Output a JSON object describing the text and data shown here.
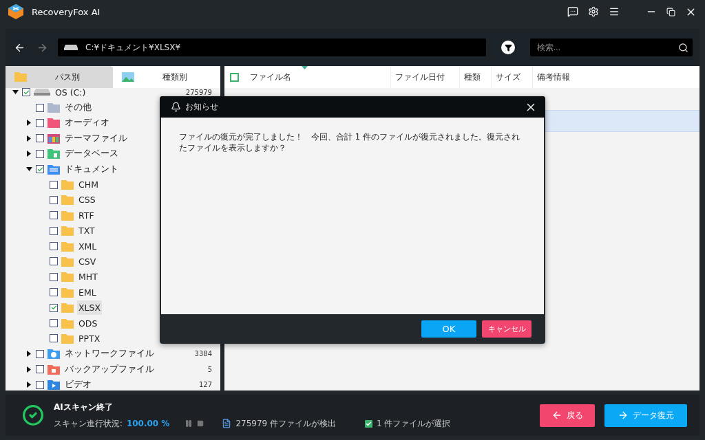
{
  "window": {
    "title": "RecoveryFox AI"
  },
  "toolbar": {
    "path": "C:¥ドキュメント¥XLSX¥",
    "search": {
      "placeholder": "検索..."
    }
  },
  "tabs": [
    {
      "label": "パス別",
      "selected": true
    },
    {
      "label": "種類別",
      "selected": false
    }
  ],
  "tree": [
    {
      "label": "OS (C:)",
      "count": "275979",
      "kind": "drive",
      "checked": true,
      "expanded": true,
      "selected": false,
      "children": [
        {
          "label": "その他",
          "kind": "other",
          "checked": false,
          "selected": false
        },
        {
          "label": "オーディオ",
          "kind": "audio",
          "checked": false,
          "expanded": false,
          "selected": false
        },
        {
          "label": "テーマファイル",
          "kind": "theme",
          "checked": false,
          "expanded": false,
          "selected": false
        },
        {
          "label": "データベース",
          "kind": "database",
          "checked": false,
          "expanded": false,
          "selected": false
        },
        {
          "label": "ドキュメント",
          "kind": "document",
          "checked": true,
          "expanded": true,
          "selected": false,
          "children": [
            {
              "label": "CHM",
              "kind": "folder",
              "checked": false,
              "selected": false
            },
            {
              "label": "CSS",
              "kind": "folder",
              "checked": false,
              "selected": false
            },
            {
              "label": "RTF",
              "kind": "folder",
              "checked": false,
              "selected": false
            },
            {
              "label": "TXT",
              "kind": "folder",
              "checked": false,
              "selected": false
            },
            {
              "label": "XML",
              "kind": "folder",
              "checked": false,
              "selected": false
            },
            {
              "label": "CSV",
              "kind": "folder",
              "checked": false,
              "selected": false
            },
            {
              "label": "MHT",
              "kind": "folder",
              "checked": false,
              "selected": false
            },
            {
              "label": "EML",
              "kind": "folder",
              "checked": false,
              "selected": false
            },
            {
              "label": "XLSX",
              "kind": "folder",
              "checked": true,
              "selected": true
            },
            {
              "label": "ODS",
              "kind": "folder",
              "checked": false,
              "selected": false
            },
            {
              "label": "PPTX",
              "kind": "folder",
              "checked": false,
              "selected": false
            }
          ]
        },
        {
          "label": "ネットワークファイル",
          "count": "3384",
          "kind": "network",
          "checked": false,
          "expanded": false,
          "selected": false
        },
        {
          "label": "バックアップファイル",
          "count": "5",
          "kind": "backup",
          "checked": false,
          "expanded": false,
          "selected": false
        },
        {
          "label": "ビデオ",
          "count": "127",
          "kind": "video",
          "checked": false,
          "expanded": false,
          "selected": false
        }
      ]
    }
  ],
  "table": {
    "header_checked": false,
    "columns": [
      "ファイル名",
      "ファイル日付",
      "種類",
      "サイズ",
      "備考情報"
    ],
    "rows": [
      {
        "selected": false
      },
      {
        "selected": true
      }
    ]
  },
  "dialog": {
    "title": "お知らせ",
    "message": "ファイルの復元が完了しました！　今回、合計 1 件のファイルが復元されました。復元されたファイルを表示しますか？",
    "buttons": [
      {
        "label": "OK",
        "kind": "primary"
      },
      {
        "label": "キャンセル",
        "kind": "danger"
      }
    ]
  },
  "status": {
    "title": "AIスキャン終了",
    "progress_label": "スキャン進行状況:",
    "progress_value": "100.00 %",
    "found": "275979 件ファイルが検出",
    "selected_checked": true,
    "selected_text": "1 件ファイルが選択"
  },
  "actions": [
    {
      "label": "戻る",
      "kind": "back"
    },
    {
      "label": "データ復元",
      "kind": "recover"
    }
  ]
}
